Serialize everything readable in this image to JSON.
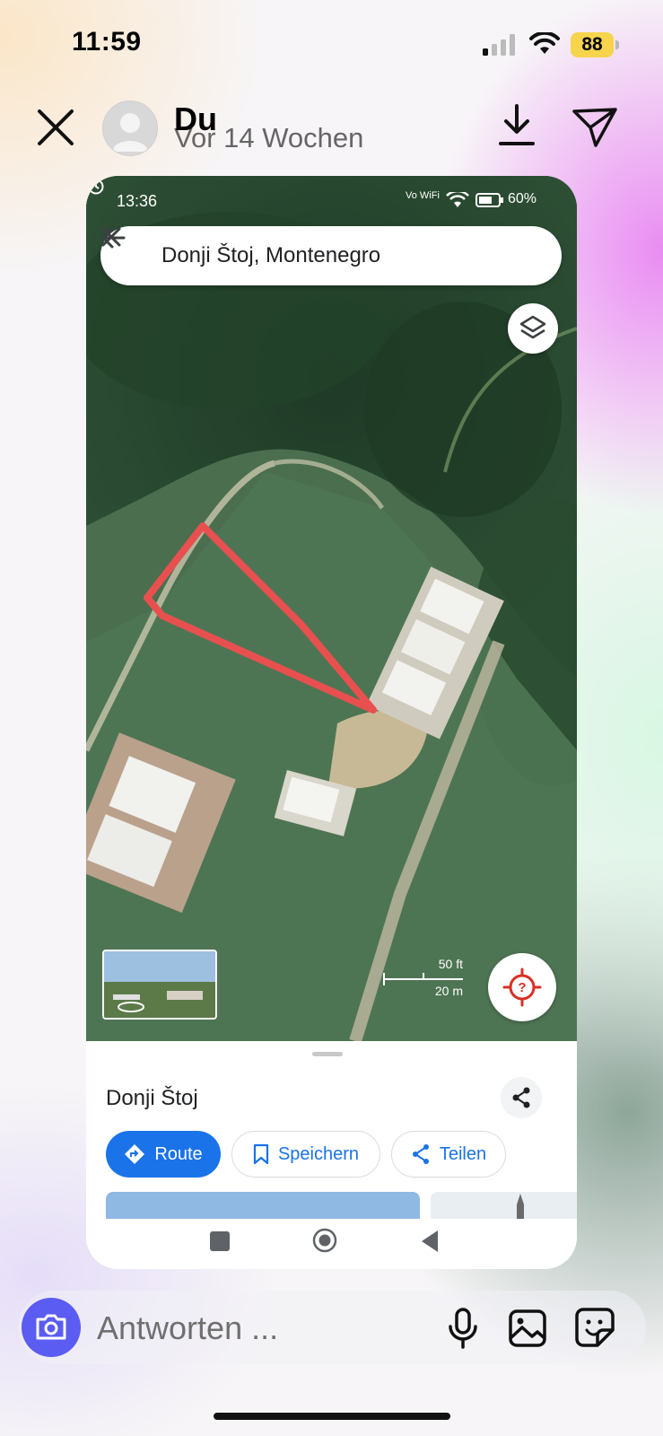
{
  "status_bar": {
    "time": "11:59",
    "battery": "88"
  },
  "story": {
    "user": "Du",
    "posted": "Vor 14 Wochen"
  },
  "shared_screenshot": {
    "status": {
      "time": "13:36",
      "network": "Vo WiFi",
      "battery": "60%"
    },
    "search": {
      "query": "Donji Štoj, Montenegro"
    },
    "scale": {
      "feet": "50 ft",
      "meters": "20 m"
    },
    "place": {
      "name": "Donji Štoj",
      "actions": {
        "route": "Route",
        "save": "Speichern",
        "share": "Teilen"
      }
    }
  },
  "reply": {
    "placeholder": "Antworten ..."
  },
  "colors": {
    "accent": "#1a73e8",
    "camera": "#5b5cf2",
    "annotation": "#e85050"
  }
}
